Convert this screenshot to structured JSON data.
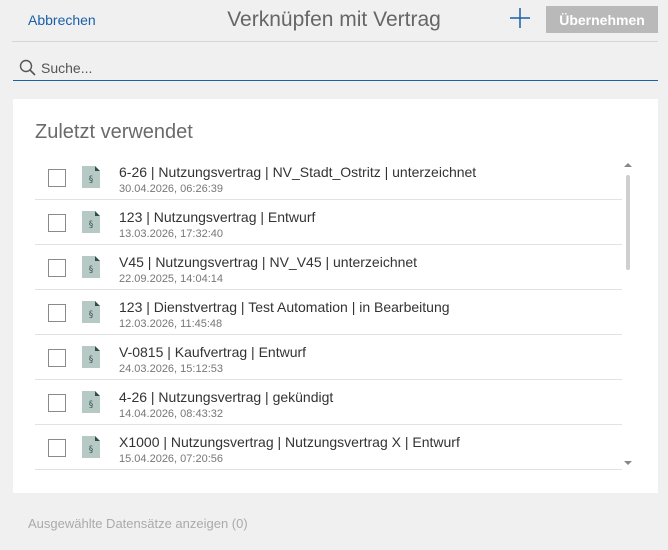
{
  "header": {
    "cancel_label": "Abbrechen",
    "title": "Verknüpfen mit Vertrag",
    "apply_label": "Übernehmen",
    "add_icon": "plus-icon"
  },
  "search": {
    "placeholder": "Suche...",
    "value": "",
    "icon": "search-icon"
  },
  "recent": {
    "title": "Zuletzt verwendet",
    "items": [
      {
        "title": "6-26 | Nutzungsvertrag | NV_Stadt_Ostritz | unterzeichnet",
        "date": "30.04.2026, 06:26:39",
        "checked": false
      },
      {
        "title": "123 | Nutzungsvertrag | Entwurf",
        "date": "13.03.2026, 17:32:40",
        "checked": false
      },
      {
        "title": "V45 | Nutzungsvertrag | NV_V45 | unterzeichnet",
        "date": "22.09.2025, 14:04:14",
        "checked": false
      },
      {
        "title": "123 | Dienstvertrag | Test Automation | in Bearbeitung",
        "date": "12.03.2026, 11:45:48",
        "checked": false
      },
      {
        "title": "V-0815 | Kaufvertrag | Entwurf",
        "date": "24.03.2026, 15:12:53",
        "checked": false
      },
      {
        "title": "4-26 | Nutzungsvertrag | gekündigt",
        "date": "14.04.2026, 08:43:32",
        "checked": false
      },
      {
        "title": "X1000 | Nutzungsvertrag | Nutzungsvertrag X | Entwurf",
        "date": "15.04.2026, 07:20:56",
        "checked": false
      }
    ]
  },
  "footer": {
    "selected_label": "Ausgewählte Datensätze anzeigen (0)"
  },
  "colors": {
    "accent": "#1a5fa8",
    "button_disabled": "#b9b9b9",
    "document_icon": "#b7c9c4"
  }
}
